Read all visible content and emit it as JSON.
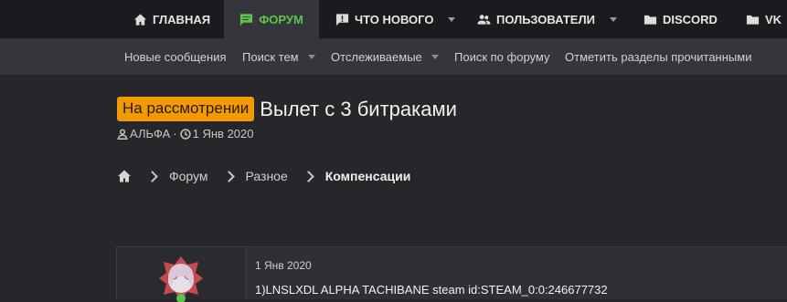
{
  "topnav": {
    "items": [
      {
        "label": "ГЛАВНАЯ",
        "icon": "home-icon"
      },
      {
        "label": "ФОРУМ",
        "icon": "chat-icon",
        "active": true
      },
      {
        "label": "ЧТО НОВОГО",
        "icon": "alert-icon",
        "dropdown": true
      },
      {
        "label": "ПОЛЬЗОВАТЕЛИ",
        "icon": "users-icon",
        "dropdown": true
      },
      {
        "label": "DISCORD",
        "icon": "folder-icon"
      },
      {
        "label": "VK",
        "icon": "folder-icon"
      }
    ],
    "active_color": "#5ec44a"
  },
  "subnav": {
    "items": [
      {
        "label": "Новые сообщения"
      },
      {
        "label": "Поиск тем",
        "dropdown": true
      },
      {
        "label": "Отслеживаемые",
        "dropdown": true
      },
      {
        "label": "Поиск по форуму"
      },
      {
        "label": "Отметить разделы прочитанными"
      }
    ]
  },
  "thread": {
    "prefix": "На рассмотрении",
    "prefix_color": "#f29a05",
    "title": "Вылет с 3 битраками",
    "author": "АЛЬФА",
    "separator": "·",
    "date": "1 Янв 2020"
  },
  "breadcrumb": {
    "home_icon": "home-icon",
    "items": [
      "Форум",
      "Разное",
      "Компенсации"
    ]
  },
  "post": {
    "date": "1 Янв 2020",
    "text": "1)LNSLXDL ALPHA TACHIBANE steam id:STEAM_0:0:246677732"
  }
}
